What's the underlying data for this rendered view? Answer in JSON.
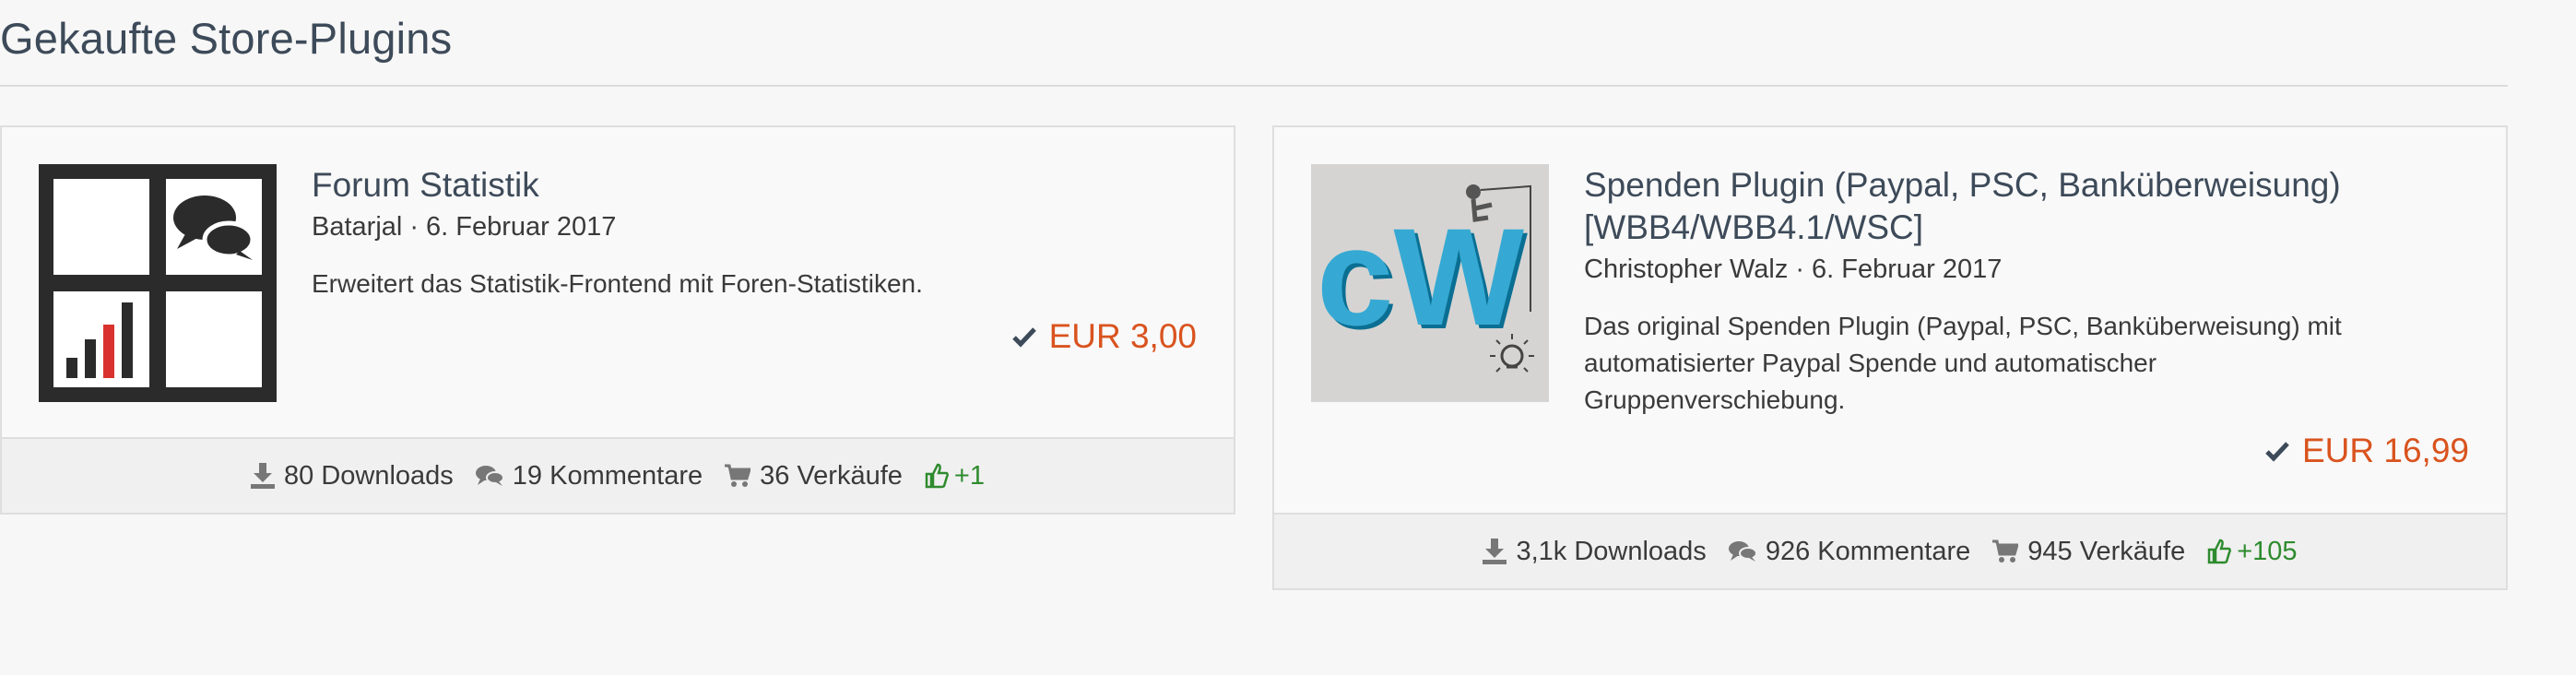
{
  "page": {
    "title": "Gekaufte Store-Plugins"
  },
  "plugins": [
    {
      "title": "Forum Statistik",
      "author": "Batarjal",
      "date": "6. Februar 2017",
      "description": "Erweitert das Statistik-Frontend mit Foren-Statistiken.",
      "price": "EUR 3,00",
      "thumbnail_icon": "forum-statistik-logo",
      "stats": {
        "downloads": "80 Downloads",
        "comments": "19 Kommentare",
        "sales": "36 Verkäufe",
        "likes": "+1"
      }
    },
    {
      "title_line1": "Spenden Plugin (Paypal, PSC, Banküberweisung)",
      "title_line2": "[WBB4/WBB4.1/WSC]",
      "author": "Christopher Walz",
      "date": "6. Februar 2017",
      "description_line1": "Das original Spenden Plugin (Paypal, PSC, Banküberweisung) mit",
      "description_line2": "automatisierter Paypal Spende und automatischer",
      "description_line3": "Gruppenverschiebung.",
      "price": "EUR 16,99",
      "thumbnail_icon": "cw-logo",
      "thumbnail_text": "cW",
      "stats": {
        "downloads": "3,1k Downloads",
        "comments": "926 Kommentare",
        "sales": "945 Verkäufe",
        "likes": "+105"
      }
    }
  ],
  "colors": {
    "price": "#d9531e",
    "likes": "#2e8b2e",
    "title": "#3d4a59"
  }
}
